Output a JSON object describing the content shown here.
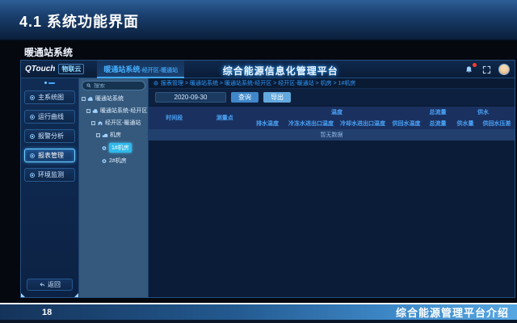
{
  "slide": {
    "title": "4.1 系统功能界面",
    "subtitle": "暖通站系统",
    "page_number": "18",
    "footer_title": "综合能源管理平台介绍"
  },
  "app": {
    "logo": {
      "brand": "QTouch",
      "suffix": "物联云"
    },
    "header": {
      "tab_main": "暖通站系统",
      "tab_sub": "-经开区-暖通站",
      "title": "综合能源信息化管理平台"
    },
    "sidebar": {
      "items": [
        {
          "label": "主系统图",
          "active": false
        },
        {
          "label": "运行曲线",
          "active": false
        },
        {
          "label": "报警分析",
          "active": false
        },
        {
          "label": "报表管理",
          "active": true
        },
        {
          "label": "环境监测",
          "active": false
        }
      ],
      "back_label": "返回"
    },
    "tree": {
      "search_placeholder": "搜索",
      "nodes": [
        {
          "label": "暖通站系统",
          "level": 0,
          "selected": false
        },
        {
          "label": "暖通站系统-经开区",
          "level": 1,
          "selected": false
        },
        {
          "label": "经开区-暖通站",
          "level": 2,
          "selected": false
        },
        {
          "label": "机房",
          "level": 3,
          "selected": false
        },
        {
          "label": "1#机房",
          "level": 4,
          "selected": true
        },
        {
          "label": "2#机房",
          "level": 4,
          "selected": false
        }
      ]
    },
    "main": {
      "breadcrumb": "报表管理 > 暖通站系统 > 暖通站系统-经开区 > 经开区-暖通站 > 机房 > 1#机房",
      "date_value": "2020-09-30",
      "query_label": "查询",
      "export_label": "导出",
      "table": {
        "col_time": "时间段",
        "col_point": "测量点",
        "group_temp": "温度",
        "group_flow": "总流量",
        "group_supply": "供水",
        "sub_temp_1": "排水温度",
        "sub_temp_2": "冷冻水进出口温度",
        "sub_temp_3": "冷却水进出口温度",
        "sub_temp_4": "供回水温度",
        "sub_flow_1": "总流量",
        "sub_supply_1": "供水量",
        "sub_supply_2": "供回水压差",
        "empty_text": "暂无数据"
      }
    }
  },
  "colors": {
    "accent_blue": "#3fa9ff",
    "selected_cyan": "#2fb9ea",
    "header_bar": "#1b4272",
    "footer_gradient_end": "#57a7e2",
    "button_query": "#3f87c9",
    "button_export": "#63a9de",
    "badge_red": "#ff3b30"
  }
}
